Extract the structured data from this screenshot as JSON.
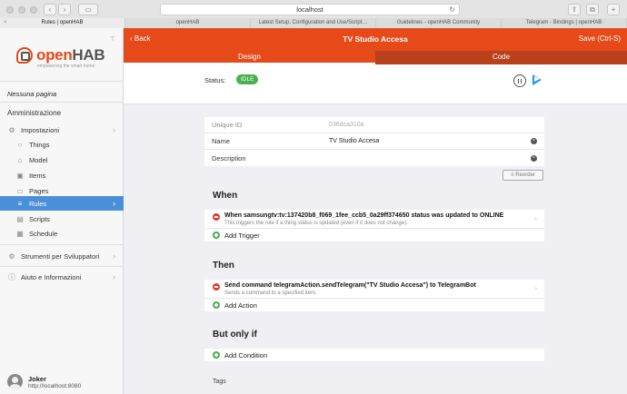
{
  "browser": {
    "url": "localhost",
    "tabs": [
      {
        "label": "Rules | openHAB",
        "active": true
      },
      {
        "label": "openHAB",
        "active": false
      },
      {
        "label": "Latest Setup, Configuration and Use/Script…",
        "active": false
      },
      {
        "label": "Guidelines - openHAB Community",
        "active": false
      },
      {
        "label": "Telegram - Bindings | openHAB",
        "active": false
      }
    ]
  },
  "sidebar": {
    "brand": "open",
    "brand_bold": "HAB",
    "brand_tagline": "empowering the smart home",
    "no_page": "Nessuna pagina",
    "section_admin": "Amministrazione",
    "items": [
      {
        "label": "Impostazioni",
        "icon": "gear-icon"
      },
      {
        "label": "Things",
        "icon": "lightbulb-icon"
      },
      {
        "label": "Model",
        "icon": "model-icon"
      },
      {
        "label": "Items",
        "icon": "items-icon"
      },
      {
        "label": "Pages",
        "icon": "pages-icon"
      },
      {
        "label": "Rules",
        "icon": "rules-icon"
      },
      {
        "label": "Scripts",
        "icon": "scripts-icon"
      },
      {
        "label": "Schedule",
        "icon": "calendar-icon"
      }
    ],
    "dev_tools": "Strumenti per Sviluppatori",
    "help": "Aiuto e Informazioni",
    "user_name": "Joker",
    "user_url": "http://localhost:8080"
  },
  "header": {
    "back": "Back",
    "title": "TV Studio Accesa",
    "save": "Save (Ctrl-S)",
    "tab_design": "Design",
    "tab_code": "Code"
  },
  "status": {
    "label": "Status:",
    "value": "IDLE",
    "badge_color": "#4caf50"
  },
  "form": {
    "uid_label": "Unique ID",
    "uid_value": "036dca310a",
    "name_label": "Name",
    "name_value": "TV Studio Accesa",
    "description_label": "Description",
    "description_value": ""
  },
  "reorder": "Reorder",
  "when": {
    "heading": "When",
    "trigger_title": "When samsungtv:tv:137420b8_f069_1fee_ccb5_0a29ff374650 status was updated to ONLINE",
    "trigger_desc": "This triggers the rule if a thing status is updated (even if it does not change).",
    "add": "Add Trigger"
  },
  "then": {
    "heading": "Then",
    "action_title": "Send command telegramAction.sendTelegram(\"TV Studio Accesa\") to TelegramBot",
    "action_desc": "Sends a command to a specified item.",
    "add": "Add Action"
  },
  "only_if": {
    "heading": "But only if",
    "add": "Add Condition"
  },
  "tags_label": "Tags",
  "colors": {
    "accent": "#e64a19",
    "active_nav": "#4a90d9",
    "play": "#2196f3"
  }
}
